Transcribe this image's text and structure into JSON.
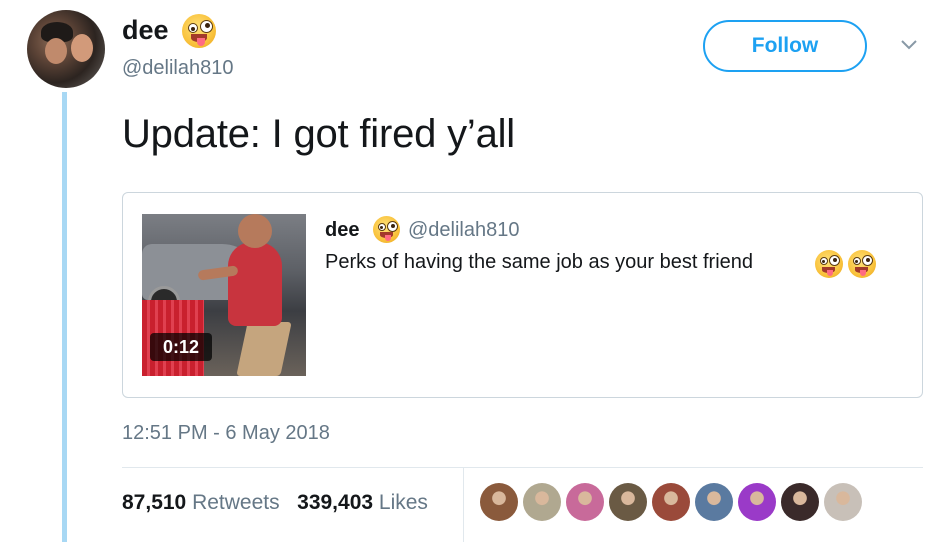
{
  "author": {
    "display_name": "dee",
    "handle": "@delilah810",
    "name_emoji": "zany-face-emoji"
  },
  "follow_label": "Follow",
  "tweet_text": "Update: I got fired y’all",
  "quoted_tweet": {
    "display_name": "dee",
    "handle": "@delilah810",
    "text": "Perks of having the same job as your best friend",
    "video_duration": "0:12"
  },
  "timestamp": "12:51 PM - 6 May 2018",
  "stats": {
    "retweets_count": "87,510",
    "retweets_label": "Retweets",
    "likes_count": "339,403",
    "likes_label": "Likes"
  },
  "likers": [
    {
      "color": "#8a5a3c"
    },
    {
      "color": "#b0a890"
    },
    {
      "color": "#c86a9a"
    },
    {
      "color": "#6a5a44"
    },
    {
      "color": "#9a4a3a"
    },
    {
      "color": "#5a7aa0"
    },
    {
      "color": "#9a3ac8"
    },
    {
      "color": "#3a2a2a"
    },
    {
      "color": "#c8c0b8"
    }
  ],
  "colors": {
    "accent": "#1da1f2",
    "secondary_text": "#657786",
    "thread_line": "#a8d8f4"
  }
}
